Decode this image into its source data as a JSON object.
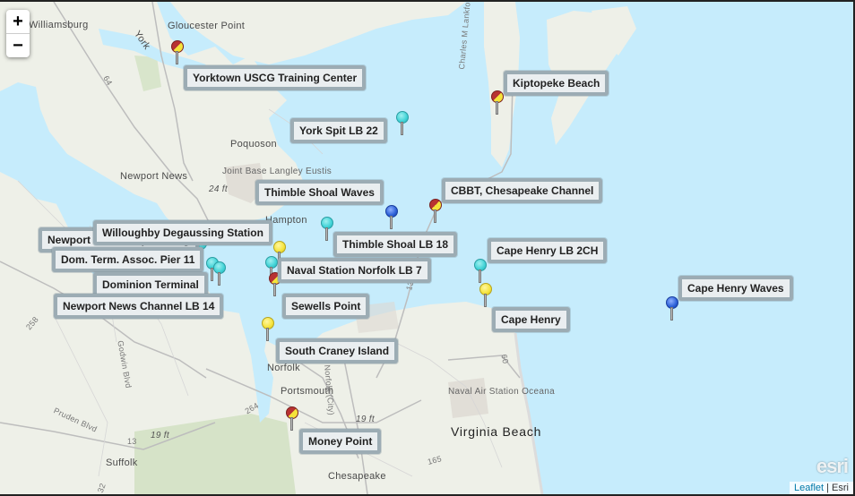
{
  "map": {
    "zoom_controls": {
      "zoom_in": "+",
      "zoom_out": "−"
    },
    "attribution": {
      "leaflet": "Leaflet",
      "separator": "|",
      "provider": "Esri"
    },
    "logo": "esri",
    "colors": {
      "water": "#c6ecfc",
      "land": "#eef0e8",
      "marker_cyan": "#3fd2d6",
      "marker_yellow": "#f5e33a",
      "marker_blue": "#2a5fd6",
      "marker_red": "#b83232"
    },
    "places": [
      {
        "name": "Williamsburg"
      },
      {
        "name": "Gloucester Point"
      },
      {
        "name": "York"
      },
      {
        "name": "Poquoson"
      },
      {
        "name": "Newport News"
      },
      {
        "name": "Joint Base Langley Eustis"
      },
      {
        "name": "Hampton"
      },
      {
        "name": "Norfolk"
      },
      {
        "name": "Portsmouth"
      },
      {
        "name": "Suffolk"
      },
      {
        "name": "Chesapeake"
      },
      {
        "name": "Naval Air Station Oceana"
      },
      {
        "name": "Virginia Beach"
      },
      {
        "name": "Charles M Lankford Jr Memorial Hwy"
      },
      {
        "name": "Pruden Blvd"
      },
      {
        "name": "Godwin Blvd"
      },
      {
        "name": "Norfolk (City)"
      }
    ],
    "elevations": [
      "24 ft",
      "19 ft",
      "19 ft"
    ],
    "road_numbers": [
      "64",
      "13",
      "264",
      "60",
      "165",
      "258",
      "13",
      "32"
    ],
    "stations": [
      {
        "name": "Yorktown USCG Training Center",
        "marker": "red-yellow"
      },
      {
        "name": "York Spit LB 22",
        "marker": "cyan"
      },
      {
        "name": "Kiptopeke Beach",
        "marker": "red-yellow"
      },
      {
        "name": "Thimble Shoal Waves",
        "marker": "blue"
      },
      {
        "name": "CBBT, Chesapeake Channel",
        "marker": "red-yellow"
      },
      {
        "name": "Willoughby Degaussing Station",
        "marker": "yellow"
      },
      {
        "name": "Newport News Shipbuilding",
        "marker": "cyan"
      },
      {
        "name": "Thimble Shoal LB 18",
        "marker": "cyan"
      },
      {
        "name": "Dom. Term. Assoc. Pier 11",
        "marker": "cyan"
      },
      {
        "name": "Cape Henry LB 2CH",
        "marker": "cyan"
      },
      {
        "name": "Naval Station Norfolk LB 7",
        "marker": "cyan"
      },
      {
        "name": "Dominion Terminal",
        "marker": "cyan"
      },
      {
        "name": "Cape Henry Waves",
        "marker": "blue"
      },
      {
        "name": "Newport News Channel LB 14",
        "marker": "yellow"
      },
      {
        "name": "Sewells Point",
        "marker": "red-yellow"
      },
      {
        "name": "Cape Henry",
        "marker": "yellow"
      },
      {
        "name": "South Craney Island",
        "marker": "yellow"
      },
      {
        "name": "Money Point",
        "marker": "red-yellow"
      }
    ]
  }
}
